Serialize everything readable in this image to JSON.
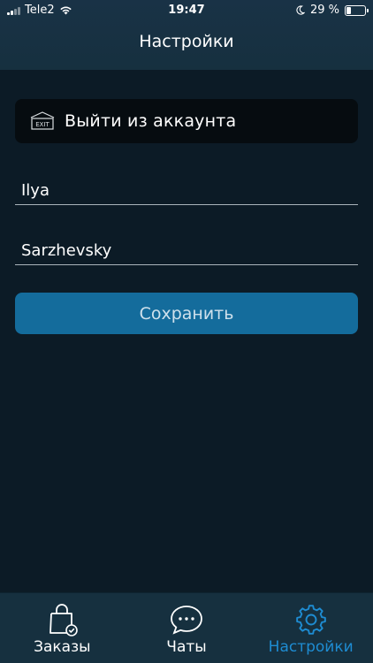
{
  "status_bar": {
    "carrier": "Tele2",
    "time": "19:47",
    "battery_percent": "29 %",
    "battery_level": 0.29
  },
  "nav": {
    "title": "Настройки"
  },
  "logout": {
    "label": "Выйти из аккаунта",
    "icon": "exit-sign-icon",
    "icon_text": "EXIT"
  },
  "form": {
    "first_name": "Ilya",
    "last_name": "Sarzhevsky",
    "save_label": "Сохранить"
  },
  "tabs": [
    {
      "label": "Заказы",
      "icon": "shopping-bag-check-icon"
    },
    {
      "label": "Чаты",
      "icon": "chat-bubble-icon"
    },
    {
      "label": "Настройки",
      "icon": "gear-icon",
      "active": true
    }
  ],
  "colors": {
    "background": "#0c1b26",
    "header": "#16303f",
    "accent": "#1e8cd2",
    "save_button": "#146c9c",
    "logout_button": "#060c10"
  }
}
